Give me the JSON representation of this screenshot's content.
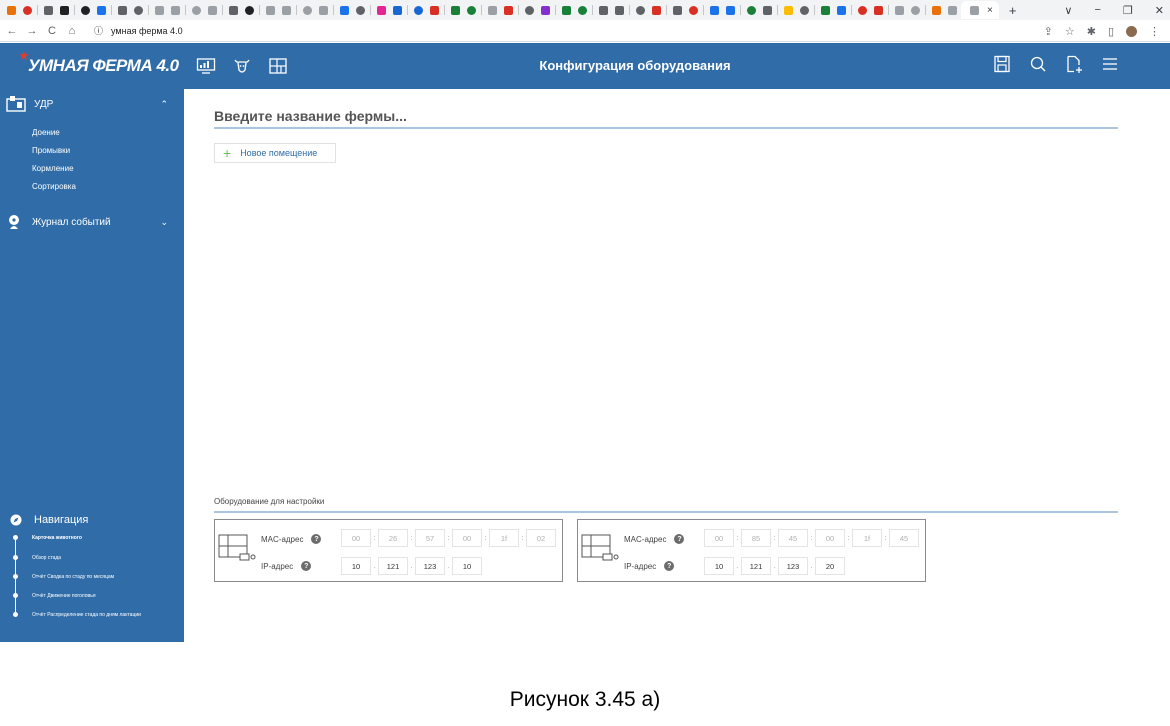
{
  "browser": {
    "tab_title": "×",
    "new_tab": "+",
    "window_controls": [
      "∨",
      "−",
      "❐",
      "✕"
    ],
    "url": "умная ферма 4.0",
    "nav": [
      "←",
      "→",
      "C",
      "⌂"
    ],
    "favicon_colors": [
      "#e8710a",
      "#d93025",
      "#5f6368",
      "#202124",
      "#202124",
      "#1a73e8",
      "#5f6368",
      "#5f6368",
      "#9aa0a6",
      "#9aa0a6",
      "#9aa0a6",
      "#9aa0a6",
      "#5f6368",
      "#202124",
      "#9aa0a6",
      "#9aa0a6",
      "#9aa0a6",
      "#9aa0a6",
      "#1a73e8",
      "#5f6368",
      "#e52592",
      "#1967d2",
      "#1967d2",
      "#d93025",
      "#188038",
      "#188038",
      "#9aa0a6",
      "#d93025",
      "#5f6368",
      "#8430ce",
      "#188038",
      "#188038",
      "#5f6368",
      "#5f6368",
      "#5f6368",
      "#d93025",
      "#5f6368",
      "#d93025",
      "#1a73e8",
      "#1a73e8",
      "#188038",
      "#5f6368",
      "#fbbc04",
      "#5f6368",
      "#188038",
      "#1a73e8",
      "#d93025",
      "#d93025",
      "#9aa0a6",
      "#9aa0a6",
      "#e8710a",
      "#9aa0a6"
    ]
  },
  "header": {
    "logo_text": "УМНАЯ ФЕРМА 4.0",
    "title": "Конфигурация оборудования",
    "left_icons": [
      "monitor-chart-icon",
      "cow-head-icon",
      "floor-plan-icon"
    ],
    "right_icons": [
      "save-icon",
      "search-icon",
      "add-file-icon",
      "menu-icon"
    ]
  },
  "sidebar": {
    "udr": {
      "label": "УДР",
      "chevron": "⌃",
      "items": [
        "Доение",
        "Промывки",
        "Кормление",
        "Сортировка"
      ]
    },
    "journal": {
      "label": "Журнал событий",
      "chevron": "⌄"
    },
    "navigation": {
      "title": "Навигация",
      "links": [
        "Карточка животного",
        "Обзор стада",
        "Отчёт Сводка по стаду по месяцам",
        "Отчёт Движение поголовья",
        "Отчёт Распределение стада по дням лактации"
      ]
    }
  },
  "main": {
    "farm_name_placeholder": "Введите название фермы...",
    "new_room_plus": "+",
    "new_room_label": "Новое помещение",
    "equipment_title": "Оборудование для настройки",
    "mac_label": "MAC-адрес",
    "ip_label": "IP-адрес",
    "help_glyph": "?",
    "devices": [
      {
        "mac": [
          "00",
          "26",
          "57",
          "00",
          "1f",
          "02"
        ],
        "ip": [
          "10",
          "121",
          "123",
          "10"
        ]
      },
      {
        "mac": [
          "00",
          "85",
          "45",
          "00",
          "1f",
          "45"
        ],
        "ip": [
          "10",
          "121",
          "123",
          "20"
        ]
      }
    ]
  },
  "caption": "Рисунок 3.45 а)",
  "colors": {
    "brand_blue": "#2f6ca8",
    "accent_green": "#6bc15a",
    "underline": "#a9c5e2",
    "logo_red": "#e23c2c"
  }
}
